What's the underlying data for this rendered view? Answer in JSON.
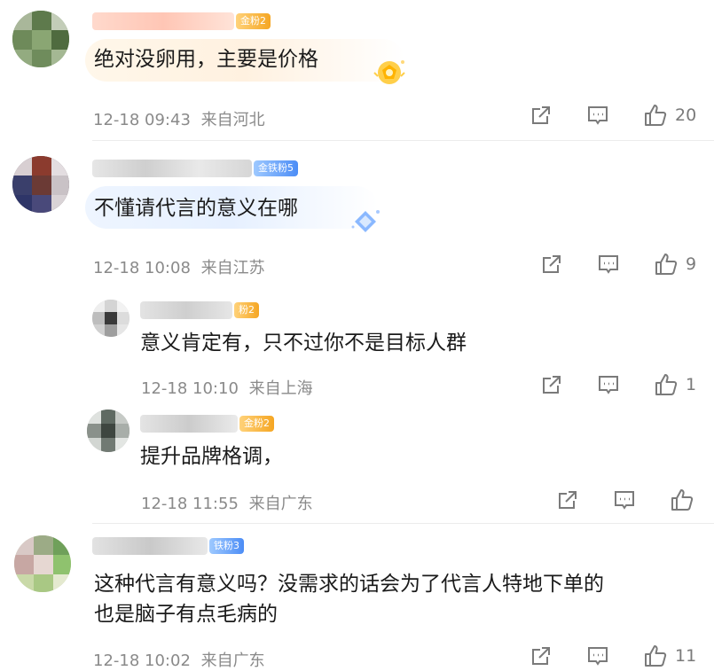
{
  "comments": [
    {
      "text": "绝对没卵用，主要是价格",
      "badge": "金粉2",
      "time": "12-18 09:43",
      "location": "来自河北",
      "likes": "20"
    },
    {
      "text": "不懂请代言的意义在哪",
      "badge": "金铁粉5",
      "time": "12-18 10:08",
      "location": "来自江苏",
      "likes": "9",
      "replies": [
        {
          "text": "意义肯定有，只不过你不是目标人群",
          "badge": "粉2",
          "time": "12-18 10:10",
          "location": "来自上海",
          "likes": "1"
        },
        {
          "text": "提升品牌格调，",
          "badge": "金粉2",
          "time": "12-18 11:55",
          "location": "来自广东",
          "likes": ""
        }
      ]
    },
    {
      "text_line1": "这种代言有意义吗？没需求的话会为了代言人特地下单的",
      "text_line2": "也是脑子有点毛病的",
      "badge": "铁粉3",
      "time": "12-18 10:02",
      "location": "来自广东",
      "likes": "11"
    }
  ]
}
